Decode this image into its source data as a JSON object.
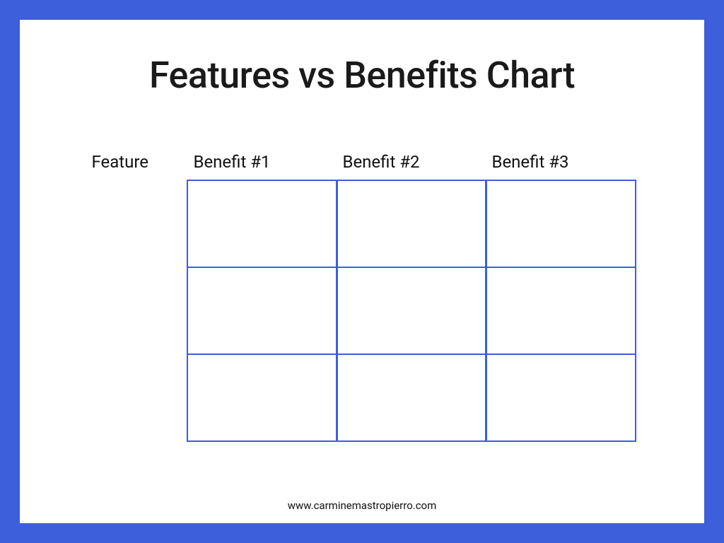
{
  "title": "Features vs Benefits Chart",
  "headers": {
    "feature": "Feature",
    "col1": "Benefit #1",
    "col2": "Benefit #2",
    "col3": "Benefit #3"
  },
  "grid": {
    "rows": 3,
    "cols": 3,
    "cells": [
      [
        "",
        "",
        ""
      ],
      [
        "",
        "",
        ""
      ],
      [
        "",
        "",
        ""
      ]
    ]
  },
  "footer": "www.carminemastropierro.com",
  "colors": {
    "border": "#3D5FD9"
  }
}
